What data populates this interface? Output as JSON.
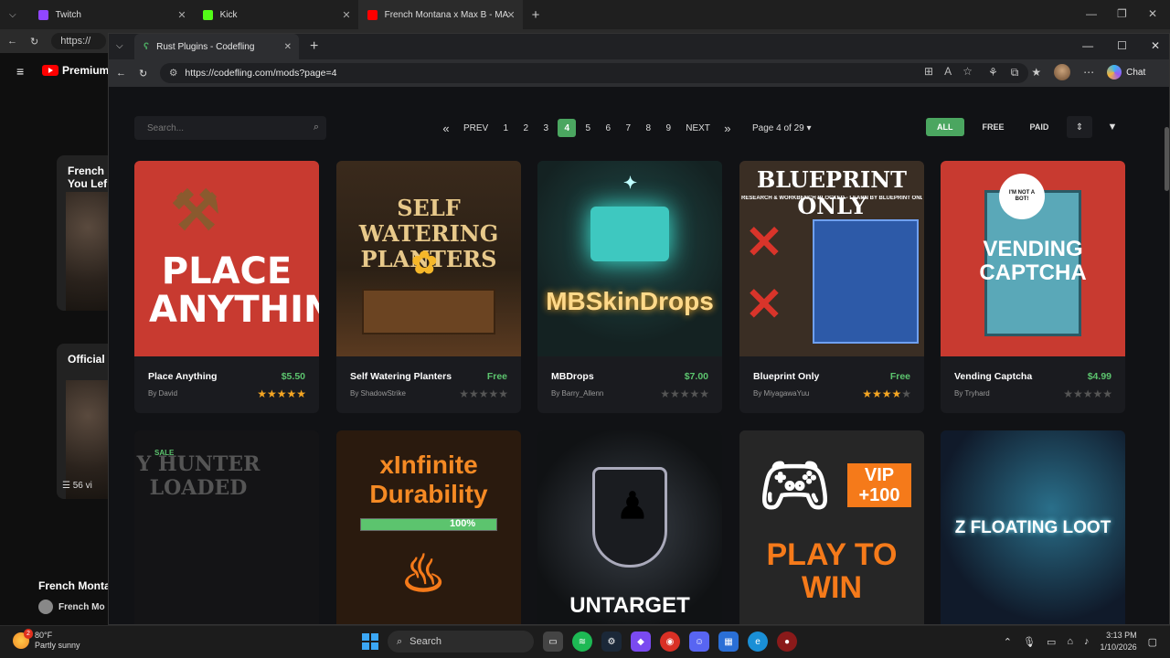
{
  "background_browser": {
    "tabs": [
      {
        "title": "Twitch",
        "color": "#9146ff"
      },
      {
        "title": "Kick",
        "color": "#53fc18"
      },
      {
        "title": "French Montana x Max B - MAWA",
        "color": "#ff0000"
      }
    ],
    "address": "https://",
    "youtube": {
      "brand": "Premium",
      "card1_title": "French You Lef",
      "card2_title": "Official",
      "card2_count": "56 vi",
      "bottom_title": "French Monta",
      "bottom_channel": "French Mo"
    }
  },
  "window": {
    "tab_title": "Rust Plugins - Codefling",
    "url": "https://codefling.com/mods?page=4",
    "chat_label": "Chat"
  },
  "toolbar": {
    "search_placeholder": "Search...",
    "prev_label": "PREV",
    "next_label": "NEXT",
    "pages": [
      "1",
      "2",
      "3",
      "4",
      "5",
      "6",
      "7",
      "8",
      "9"
    ],
    "current_page": "4",
    "page_info": "Page 4 of 29",
    "filters": [
      "ALL",
      "FREE",
      "PAID"
    ],
    "active_filter": "ALL",
    "accent": "#4ba660"
  },
  "cards": [
    {
      "name": "Place Anything",
      "price": "$5.50",
      "author": "By David",
      "rating": 5,
      "art": "PLACE ANYTHING"
    },
    {
      "name": "Self Watering Planters",
      "price": "Free",
      "author": "By ShadowStrike",
      "rating": 0,
      "art": "SELF WATERING PLANTERS"
    },
    {
      "name": "MBDrops",
      "price": "$7.00",
      "author": "By Barry_Allenn",
      "rating": 0,
      "art": "MBSkinDrops"
    },
    {
      "name": "Blueprint Only",
      "price": "Free",
      "author": "By MiyagawaYuu",
      "rating": 4,
      "art": "BLUEPRINT ONLY",
      "art_sub": "RESEARCH & WORKBENCH BLOCKED - LEARN BY BLUEPRINT ONLY"
    },
    {
      "name": "Vending Captcha",
      "price": "$4.99",
      "author": "By Tryhard",
      "rating": 0,
      "art": "VENDING CAPTCHA",
      "art_sub": "I'M NOT A BOT!"
    }
  ],
  "cards_row2": [
    {
      "art": "Y HUNTER LOADED",
      "badge": "SALE"
    },
    {
      "art": "xInfinite Durability",
      "art_sub": "100%"
    },
    {
      "art": "UNTARGET"
    },
    {
      "art": "PLAY TO WIN",
      "art_sub": "VIP +100"
    },
    {
      "art": "Z FLOATING LOOT"
    }
  ],
  "taskbar": {
    "temp": "80°F",
    "weather": "Partly sunny",
    "weather_badge": "2",
    "search_label": "Search",
    "time": "3:13 PM",
    "date": "1/10/2026"
  }
}
